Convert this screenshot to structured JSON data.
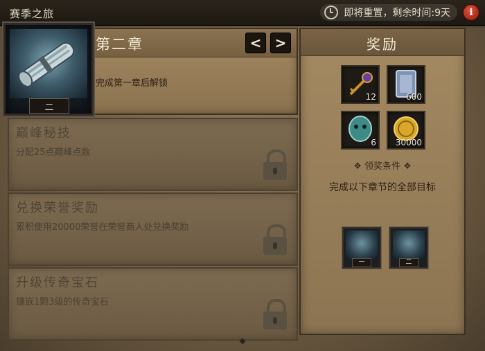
{
  "header": {
    "title": "赛季之旅",
    "timer_text": "即将重置，剩余时间:9天",
    "info_glyph": "i"
  },
  "chapter": {
    "title": "第二章",
    "description": "完成第一章后解锁",
    "badge": "二",
    "prev_glyph": "<",
    "next_glyph": ">"
  },
  "tasks": [
    {
      "name": "巅峰秘技",
      "description": "分配25点巅峰点数"
    },
    {
      "name": "兑换荣誉奖励",
      "description": "累积使用20000荣誉在荣誉商人处兑换奖励"
    },
    {
      "name": "升级传奇宝石",
      "description": "镶嵌1颗3级的传奇宝石"
    }
  ],
  "rewards": {
    "title": "奖励",
    "items": [
      {
        "icon": "key-icon",
        "qty": "12"
      },
      {
        "icon": "tome-icon",
        "qty": "600"
      },
      {
        "icon": "gem-mask-icon",
        "qty": "6"
      },
      {
        "icon": "gold-coin-icon",
        "qty": "30000"
      }
    ],
    "condition_title": "领奖条件",
    "condition_desc": "完成以下章节的全部目标",
    "required": [
      {
        "icon": "scroll-icon",
        "badge": "一"
      },
      {
        "icon": "scroll-icon",
        "badge": "二"
      }
    ]
  }
}
